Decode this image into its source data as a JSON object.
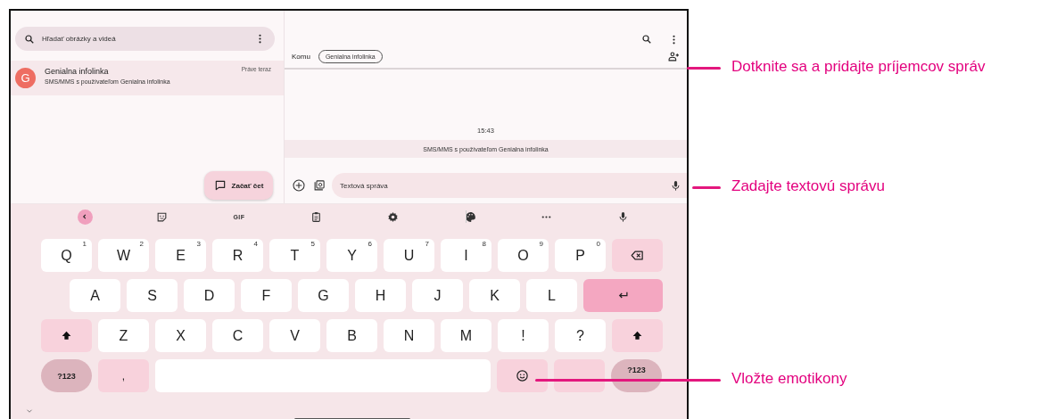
{
  "left_pane": {
    "search": {
      "placeholder": "Hľadať obrázky a videá"
    },
    "conversations": [
      {
        "avatar_letter": "G",
        "name": "Genialna infolinka",
        "preview": "SMS/MMS s používateľom Genialna infolinka",
        "time": "Práve teraz",
        "selected": true
      }
    ],
    "fab": {
      "label": "Začať čet"
    }
  },
  "conversation": {
    "to_label": "Komu",
    "recipient_chip": "Genialna infolinka",
    "timestamp": "15:43",
    "banner": "SMS/MMS s používateľom Genialna infolinka",
    "compose": {
      "placeholder": "Textová správa"
    }
  },
  "keyboard": {
    "toolbar": [
      {
        "kind": "back"
      },
      {
        "kind": "sticker"
      },
      {
        "kind": "text",
        "label": "GIF"
      },
      {
        "kind": "clipboard"
      },
      {
        "kind": "settings"
      },
      {
        "kind": "palette"
      },
      {
        "kind": "divider"
      },
      {
        "kind": "more"
      },
      {
        "kind": "mic"
      }
    ],
    "rows": [
      [
        {
          "kind": "char",
          "label": "Q",
          "hint": "1"
        },
        {
          "kind": "char",
          "label": "W",
          "hint": "2"
        },
        {
          "kind": "char",
          "label": "E",
          "hint": "3"
        },
        {
          "kind": "char",
          "label": "R",
          "hint": "4"
        },
        {
          "kind": "char",
          "label": "T",
          "hint": "5"
        },
        {
          "kind": "char",
          "label": "Y",
          "hint": "6"
        },
        {
          "kind": "char",
          "label": "U",
          "hint": "7"
        },
        {
          "kind": "char",
          "label": "I",
          "hint": "8"
        },
        {
          "kind": "char",
          "label": "O",
          "hint": "9"
        },
        {
          "kind": "char",
          "label": "P",
          "hint": "0"
        },
        {
          "kind": "backspace"
        }
      ],
      [
        {
          "kind": "char",
          "label": "A"
        },
        {
          "kind": "char",
          "label": "S"
        },
        {
          "kind": "char",
          "label": "D"
        },
        {
          "kind": "char",
          "label": "F"
        },
        {
          "kind": "char",
          "label": "G"
        },
        {
          "kind": "char",
          "label": "H"
        },
        {
          "kind": "char",
          "label": "J"
        },
        {
          "kind": "char",
          "label": "K"
        },
        {
          "kind": "char",
          "label": "L"
        },
        {
          "kind": "enter"
        }
      ],
      [
        {
          "kind": "shift"
        },
        {
          "kind": "char",
          "label": "Z"
        },
        {
          "kind": "char",
          "label": "X"
        },
        {
          "kind": "char",
          "label": "C"
        },
        {
          "kind": "char",
          "label": "V"
        },
        {
          "kind": "char",
          "label": "B"
        },
        {
          "kind": "char",
          "label": "N"
        },
        {
          "kind": "char",
          "label": "M"
        },
        {
          "kind": "char",
          "label": "!"
        },
        {
          "kind": "char",
          "label": "?"
        },
        {
          "kind": "shift"
        }
      ],
      [
        {
          "kind": "symbols",
          "label": "?123"
        },
        {
          "kind": "punct",
          "label": ","
        },
        {
          "kind": "space"
        },
        {
          "kind": "emoji"
        },
        {
          "kind": "punct"
        },
        {
          "kind": "symbols",
          "label": "?123"
        }
      ]
    ]
  },
  "annotations": [
    {
      "text": "Dotknite sa a pridajte príjemcov správ"
    },
    {
      "text": "Zadajte textovú správu"
    },
    {
      "text": "Vložte emotikony"
    }
  ]
}
